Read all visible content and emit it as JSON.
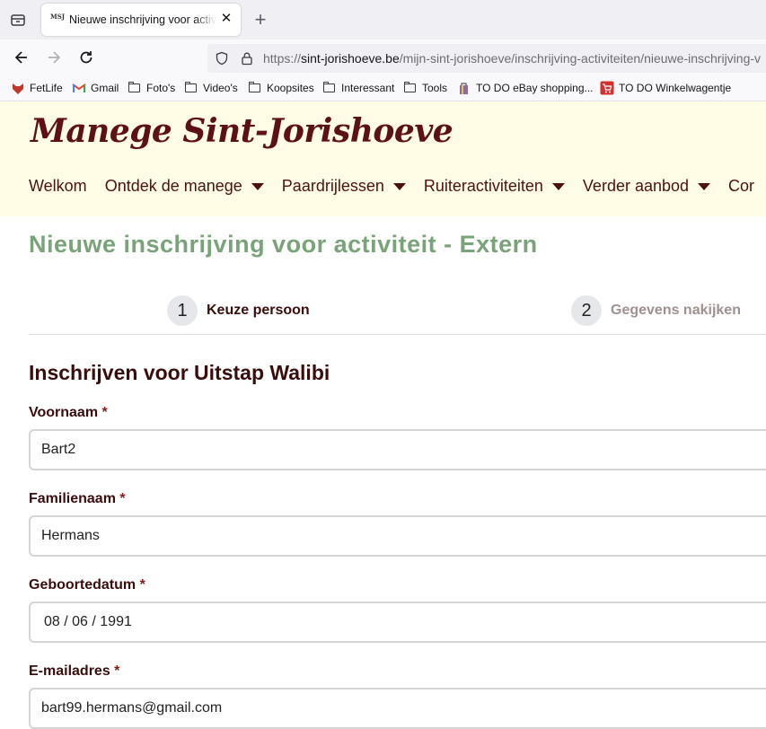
{
  "browser": {
    "tab_title": "Nieuwe inschrijving voor activiteit",
    "favicon_text": "MSJ",
    "url_prefix": "https://",
    "url_host": "sint-jorishoeve.be",
    "url_path": "/mijn-sint-jorishoeve/inschrijving-activiteiten/nieuwe-inschrijving-v",
    "bookmarks": [
      "FetLife",
      "Gmail",
      "Foto's",
      "Video's",
      "Koopsites",
      "Interessant",
      "Tools",
      "TO DO eBay shopping...",
      "TO DO Winkelwagentje"
    ]
  },
  "site": {
    "logo": "Manege Sint-Jorishoeve",
    "nav": [
      {
        "label": "Welkom"
      },
      {
        "label": "Ontdek de manege"
      },
      {
        "label": "Paardrijlessen"
      },
      {
        "label": "Ruiteractiviteiten"
      },
      {
        "label": "Verder aanbod"
      },
      {
        "label": "Cor"
      }
    ]
  },
  "page": {
    "title": "Nieuwe inschrijving voor activiteit - Extern",
    "steps": [
      {
        "number": "1",
        "label": "Keuze persoon"
      },
      {
        "number": "2",
        "label": "Gegevens nakijken"
      }
    ],
    "form_heading": "Inschrijven voor Uitstap Walibi",
    "required_marker": "*",
    "fields": {
      "voornaam": {
        "label": "Voornaam",
        "value": "Bart2"
      },
      "familienaam": {
        "label": "Familienaam",
        "value": "Hermans"
      },
      "geboortedatum": {
        "label": "Geboortedatum",
        "value": "08 / 06 / 1991"
      },
      "email": {
        "label": "E-mailadres",
        "value": "bart99.hermans@gmail.com"
      }
    }
  },
  "colors": {
    "logo": "#5e1111",
    "title": "#7aa37a",
    "header_bg": "#fffde6"
  }
}
